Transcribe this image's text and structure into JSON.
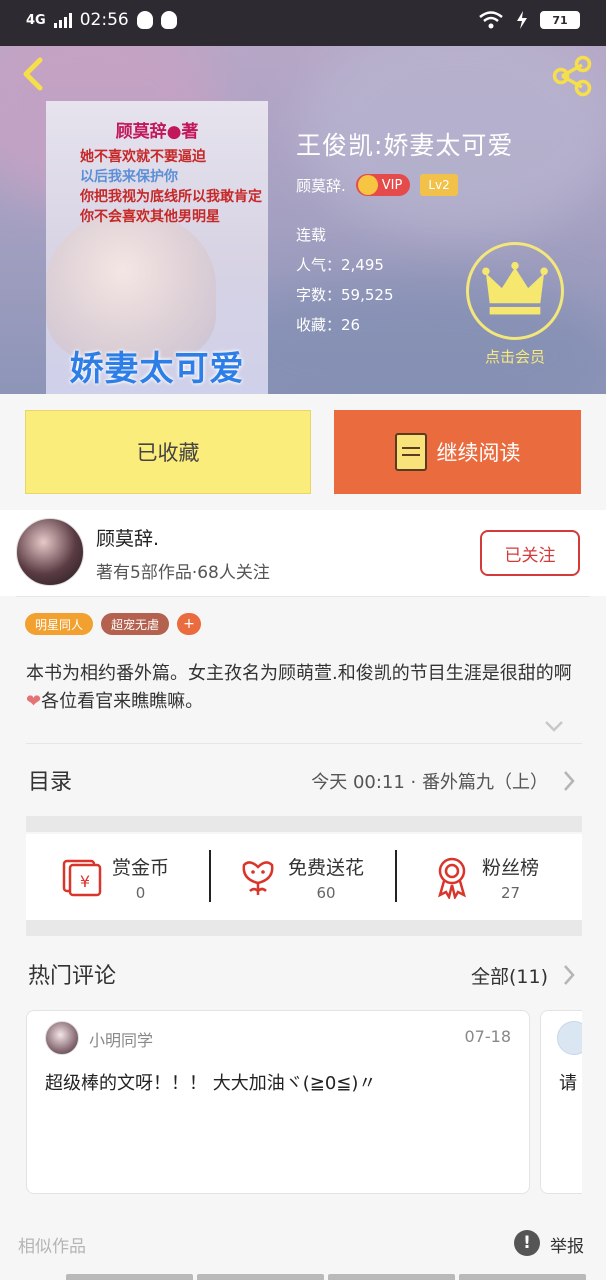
{
  "status_bar": {
    "network": "4G",
    "time": "02:56",
    "battery": "71"
  },
  "cover": {
    "author_line": "顾莫辞●著",
    "line1": "她不喜欢就不要逼迫",
    "line2": "以后我来保护你",
    "line3": "你把我视为底线所以我敢肯定你不会喜欢其他男明星",
    "big_text": "娇妻太可爱"
  },
  "book": {
    "title": "王俊凯:娇妻太可爱",
    "author": "顾莫辞.",
    "vip_label": "VIP",
    "level": "Lv2",
    "status": "连载",
    "popularity": "人气：2,495",
    "word_count": "字数：59,525",
    "favorites": "收藏：26",
    "vip_member_label": "点击会员"
  },
  "actions": {
    "favorited": "已收藏",
    "continue_reading": "继续阅读"
  },
  "author_panel": {
    "name": "顾莫辞.",
    "subtitle": "著有5部作品·68人关注",
    "follow_label": "已关注"
  },
  "tags": [
    "明星同人",
    "超宠无虐",
    "+"
  ],
  "description": {
    "part1": "本书为相约番外篇。女主孜名为顾萌萱.和俊凯的节目生涯是很甜的啊",
    "heart": "❤",
    "part2": "各位看官来瞧瞧嘛。"
  },
  "toc": {
    "label": "目录",
    "latest": "今天 00:11 · 番外篇九（上）"
  },
  "rewards": [
    {
      "title": "赏金币",
      "value": "0",
      "icon": "red-envelope-icon"
    },
    {
      "title": "免费送花",
      "value": "60",
      "icon": "flower-icon"
    },
    {
      "title": "粉丝榜",
      "value": "27",
      "icon": "medal-icon"
    }
  ],
  "comments": {
    "heading": "热门评论",
    "all_label": "全部(11)",
    "items": [
      {
        "user": "小明同学",
        "date": "07-18",
        "text": "超级棒的文呀！！！ 大大加油ヾ(≧0≦)〃"
      },
      {
        "user": "",
        "date": "",
        "text": "请"
      }
    ]
  },
  "footer": {
    "similar": "相似作品",
    "report": "举报"
  },
  "colors": {
    "accent_orange": "#ea6b3e",
    "favorite_yellow": "#fbed7b",
    "follow_red": "#d43a3a"
  }
}
